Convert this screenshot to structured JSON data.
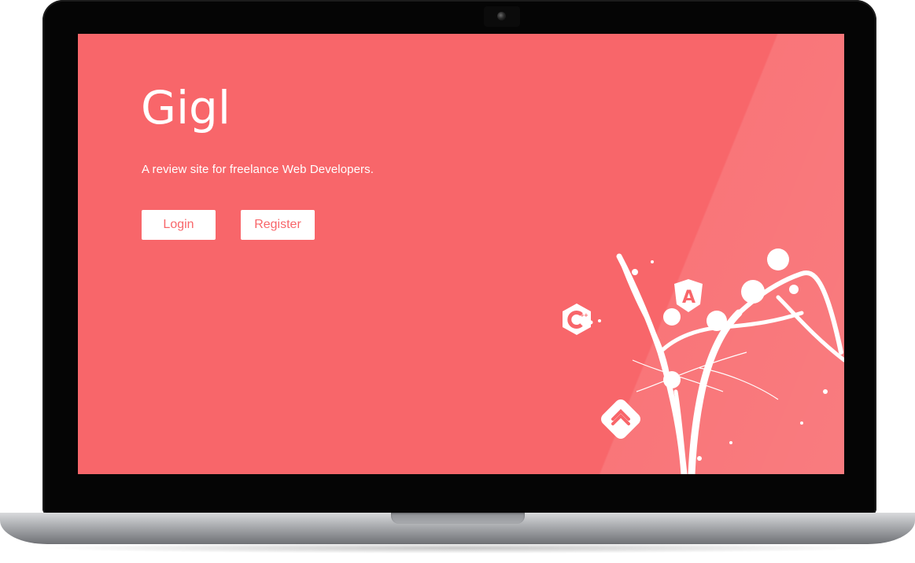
{
  "site": {
    "logo_text": "Gigl",
    "tagline": "A review site for freelance Web Developers."
  },
  "buttons": {
    "login_label": "Login",
    "register_label": "Register"
  },
  "decor": {
    "icons": [
      "cplusplus-icon",
      "angular-icon",
      "python-icon"
    ],
    "angular_glyph": "A"
  },
  "colors": {
    "background": "#f8666a",
    "button_bg": "#ffffff",
    "button_text": "#f8666a",
    "text": "#ffffff"
  }
}
